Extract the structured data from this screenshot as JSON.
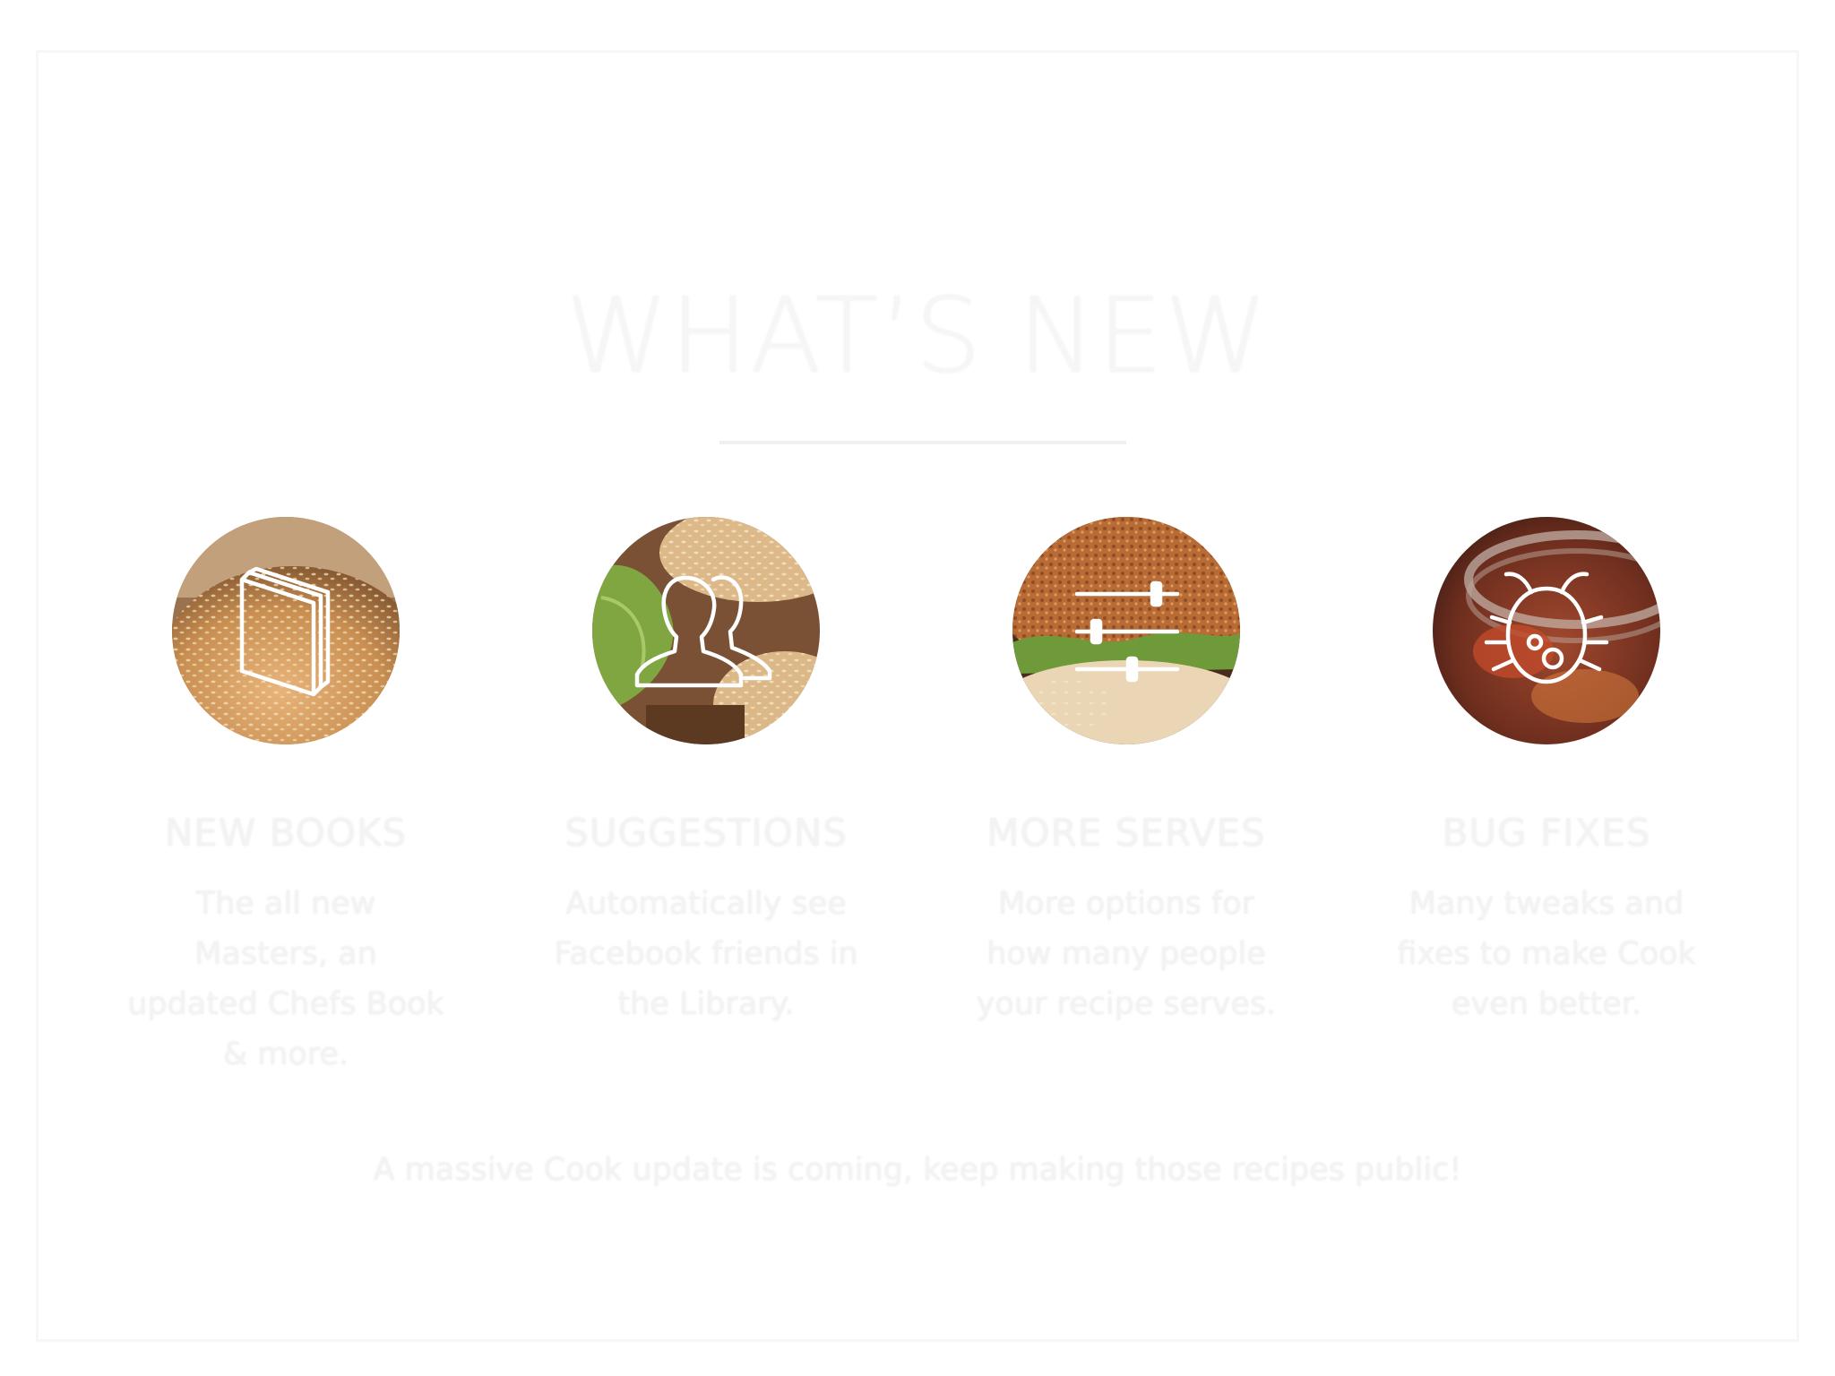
{
  "header": {
    "title": "WHAT’S NEW"
  },
  "features": [
    {
      "title": "NEW BOOKS",
      "description": "The all new Masters, an updated Chefs Book & more.",
      "icon": "book-icon"
    },
    {
      "title": "SUGGESTIONS",
      "description": "Automatically see Facebook friends in the Library.",
      "icon": "people-icon"
    },
    {
      "title": "MORE SERVES",
      "description": "More options for how many people your recipe serves.",
      "icon": "sliders-icon"
    },
    {
      "title": "BUG FIXES",
      "description": "Many tweaks and fixes to make Cook even better.",
      "icon": "bug-icon"
    }
  ],
  "footer": {
    "message": "A massive Cook update is coming, keep making those recipes public!"
  },
  "colors": {
    "text": "#f3f3f3",
    "icon_stroke": "#ffffff",
    "food_warm": "#b57a3e",
    "food_dark": "#5a3522",
    "lettuce": "#7fa640"
  }
}
